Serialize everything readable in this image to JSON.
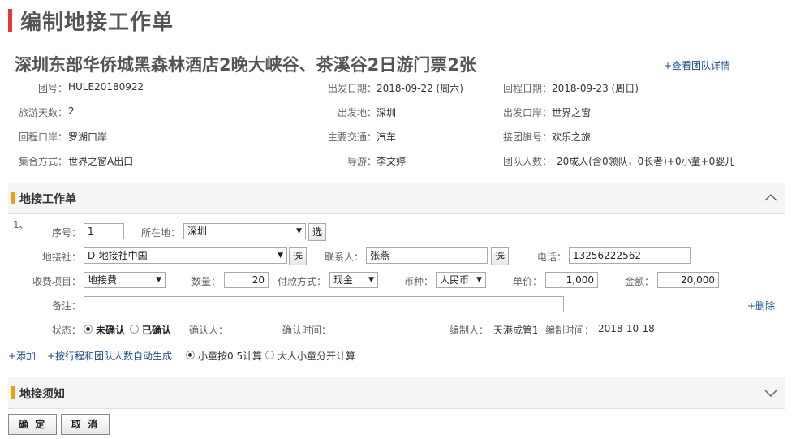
{
  "page": {
    "title": "编制地接工作单"
  },
  "group": {
    "name": "深圳东部华侨城黑森林酒店2晚大峡谷、茶溪谷2日游门票2张",
    "view_detail": "+查看团队详情",
    "info": {
      "group_no_label": "团号：",
      "group_no": "HULE20180922",
      "depart_date_label": "出发日期：",
      "depart_date": "2018-09-22 (周六)",
      "return_date_label": "回程日期：",
      "return_date": "2018-09-23 (周日)",
      "days_label": "旅游天数：",
      "days": "2",
      "depart_place_label": "出发地：",
      "depart_place": "深圳",
      "depart_port_label": "出发口岸：",
      "depart_port": "世界之窗",
      "return_port_label": "回程口岸：",
      "return_port": "罗湖口岸",
      "transport_label": "主要交通：",
      "transport": "汽车",
      "flag_label": "接团旗号：",
      "flag": "欢乐之旅",
      "assembly_label": "集合方式：",
      "assembly": "世界之窗A出口",
      "guide_label": "导游：",
      "guide": "李文婷",
      "people_label": "团队人数：",
      "people": "20成人(含0领队，0长者)+0小童+0婴儿"
    }
  },
  "worksheet": {
    "section_title": "地接工作单",
    "row_index": "1、",
    "seq_label": "序号：",
    "seq_value": "1",
    "location_label": "所在地：",
    "location_value": "深圳",
    "select_btn": "选",
    "agency_label": "地接社：",
    "agency_value": "D-地接社中国",
    "contact_label": "联系人：",
    "contact_value": "张燕",
    "phone_label": "电话：",
    "phone_value": "13256222562",
    "item_label": "收费项目：",
    "item_value": "地接费",
    "qty_label": "数量：",
    "qty_value": "20",
    "pay_label": "付款方式：",
    "pay_value": "现金",
    "currency_label": "币种：",
    "currency_value": "人民币",
    "price_label": "单价：",
    "price_value": "1,000",
    "amount_label": "金额：",
    "amount_value": "20,000",
    "remark_label": "备注：",
    "remark_value": "",
    "delete_link": "+删除",
    "status_label": "状态：",
    "status_unconfirmed": "未确认",
    "status_confirmed": "已确认",
    "confirmer_label": "确认人：",
    "confirm_time_label": "确认时间：",
    "editor_label": "编制人：",
    "editor_value": "天港成管1",
    "edit_time_label": "编制时间：",
    "edit_time_value": "2018-10-18",
    "add_link": "+添加",
    "auto_gen_link": "+按行程和团队人数自动生成",
    "child_half": "小童按0.5计算",
    "separate_calc": "大人小童分开计算"
  },
  "notice": {
    "section_title": "地接须知"
  },
  "footer": {
    "confirm": "确 定",
    "cancel": "取 消"
  },
  "colors": {
    "accent_red": "#e4393c",
    "accent_orange": "#f39c12",
    "link": "#1d4f91"
  }
}
